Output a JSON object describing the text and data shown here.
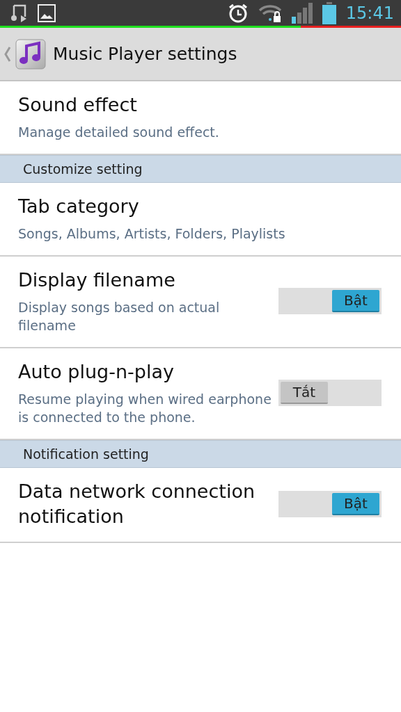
{
  "status_bar": {
    "time": "15:41"
  },
  "action_bar": {
    "title": "Music Player settings"
  },
  "items": [
    {
      "kind": "item",
      "title": "Sound effect",
      "summary": "Manage detailed sound effect."
    },
    {
      "kind": "header",
      "title": "Customize setting"
    },
    {
      "kind": "item",
      "title": "Tab category",
      "summary": "Songs, Albums, Artists, Folders, Playlists"
    },
    {
      "kind": "toggle",
      "title": "Display filename",
      "summary": "Display songs based on actual filename",
      "on": true,
      "switch_label": "Bật"
    },
    {
      "kind": "toggle",
      "title": "Auto plug-n-play",
      "summary": "Resume playing when wired earphone is connected to the phone.",
      "on": false,
      "switch_label": "Tắt"
    },
    {
      "kind": "header",
      "title": "Notification setting"
    },
    {
      "kind": "toggle",
      "title": "Data network connection notification",
      "on": true,
      "switch_label": "Bật"
    }
  ]
}
